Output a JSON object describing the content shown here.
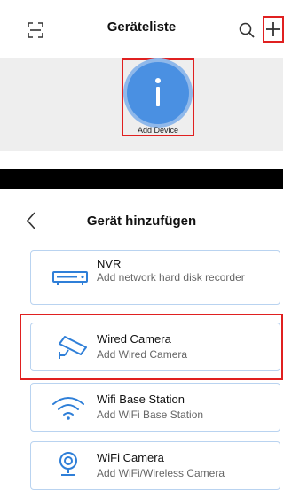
{
  "screen1": {
    "title": "Geräteliste",
    "add_device_label": "Add Device"
  },
  "screen2": {
    "title": "Gerät hinzufügen",
    "devices": [
      {
        "name": "NVR",
        "desc": "Add network hard disk recorder",
        "icon": "nvr-icon"
      },
      {
        "name": "Wired Camera",
        "desc": "Add Wired Camera",
        "icon": "camera-icon"
      },
      {
        "name": "Wifi Base Station",
        "desc": "Add WiFi Base Station",
        "icon": "wifi-icon"
      },
      {
        "name": "WiFi Camera",
        "desc": "Add WiFi/Wireless Camera",
        "icon": "wifi-camera-icon"
      }
    ]
  },
  "colors": {
    "accent_blue": "#4a90e2",
    "highlight_red": "#e02020",
    "card_border": "#b9d3f0"
  }
}
